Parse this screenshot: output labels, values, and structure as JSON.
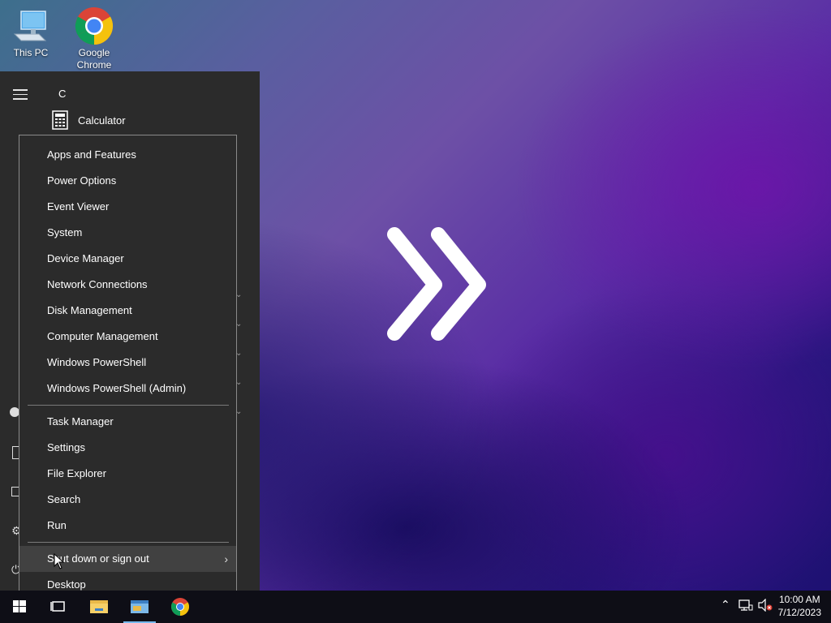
{
  "desktop": {
    "icons": [
      {
        "label": "This PC",
        "icon": "computer-icon"
      },
      {
        "label": "Google\nChrome",
        "label_line1": "Google",
        "label_line2": "Chrome",
        "icon": "chrome-icon"
      }
    ]
  },
  "start_menu": {
    "section_letter": "C",
    "apps": [
      {
        "label": "Calculator",
        "icon": "calculator-icon"
      }
    ]
  },
  "context_menu": {
    "group1": [
      "Apps and Features",
      "Power Options",
      "Event Viewer",
      "System",
      "Device Manager",
      "Network Connections",
      "Disk Management",
      "Computer Management",
      "Windows PowerShell",
      "Windows PowerShell (Admin)"
    ],
    "group2": [
      "Task Manager",
      "Settings",
      "File Explorer",
      "Search",
      "Run"
    ],
    "group3": [
      "Shut down or sign out",
      "Desktop"
    ],
    "hovered": "Shut down or sign out"
  },
  "taskbar": {
    "clock_time": "10:00 AM",
    "clock_date": "7/12/2023",
    "pinned": [
      "task-view-icon",
      "file-explorer-icon",
      "active-app-icon",
      "chrome-icon"
    ]
  },
  "colors": {
    "menu_bg": "#2b2b2b",
    "menu_hover": "#414141",
    "taskbar_bg": "#0e0e16",
    "accent": "#76b9ed"
  }
}
